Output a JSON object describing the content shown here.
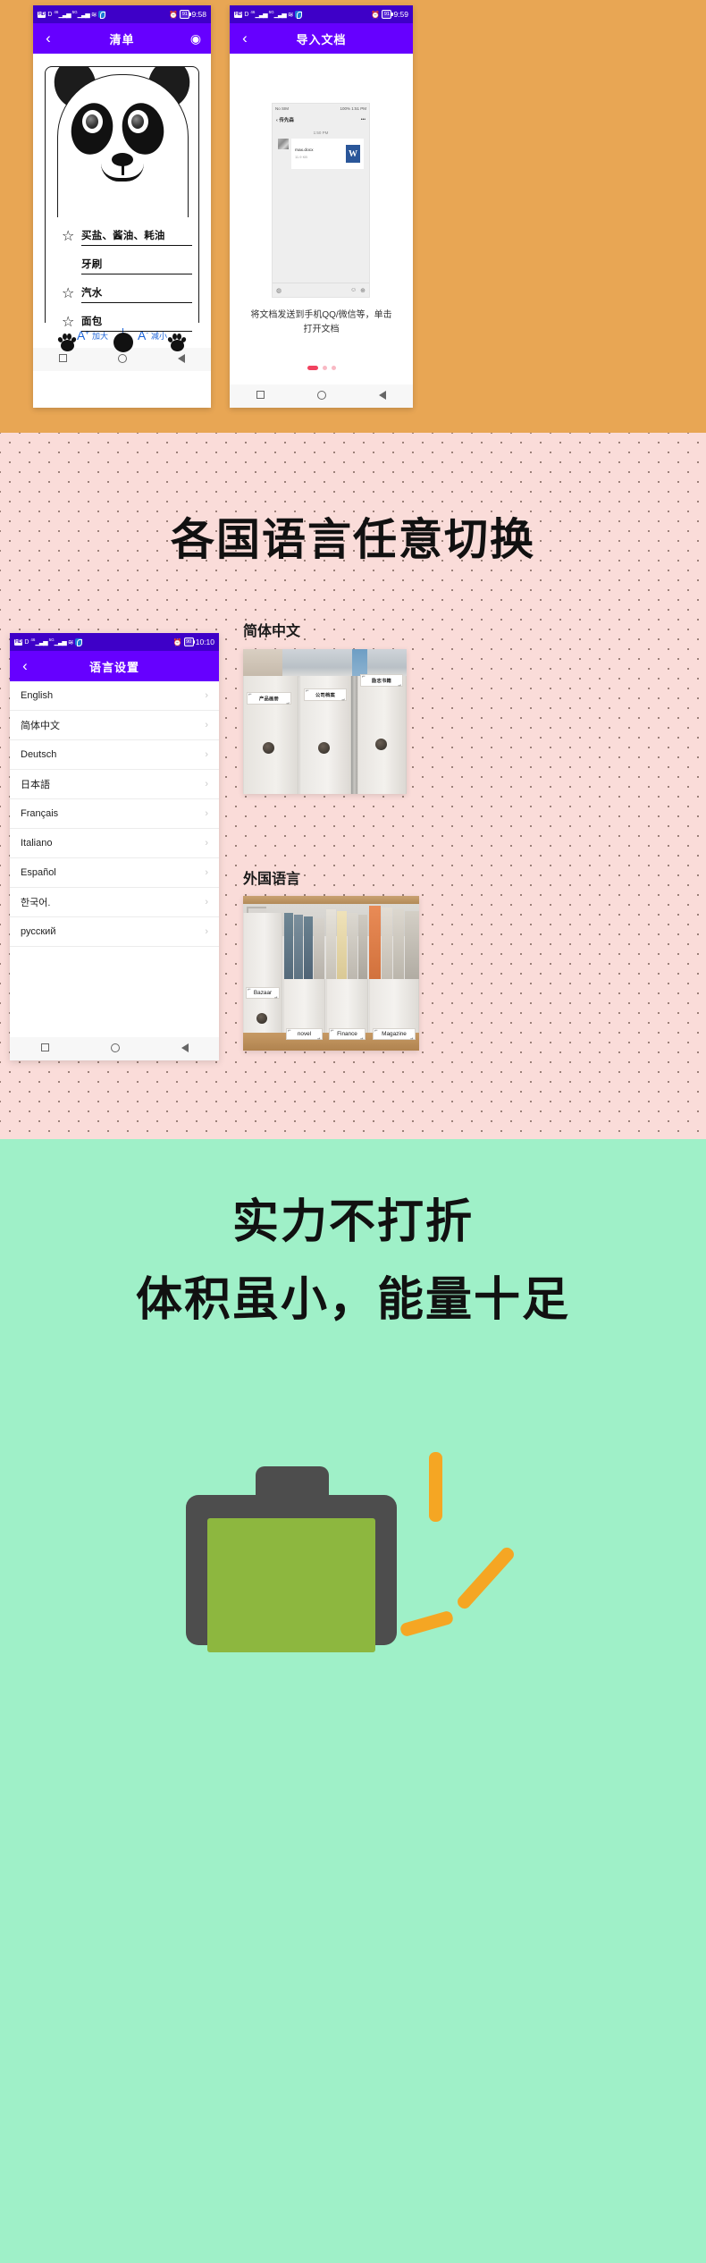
{
  "sections": {
    "top": {
      "bg_color": "#e8a654",
      "phone_list": {
        "status": {
          "hd_label": "HD",
          "data_label": "D",
          "net1": "46",
          "net2": "5G",
          "alarm_icon": "alarm-icon",
          "battery": "91",
          "time": "9:58"
        },
        "nav": {
          "back_icon": "chevron-left-icon",
          "title": "清单",
          "right_icon": "eye-icon"
        },
        "items": [
          {
            "starred": true,
            "text": "买盐、酱油、耗油"
          },
          {
            "starred": false,
            "text": "牙刷"
          },
          {
            "starred": true,
            "text": "汽水"
          },
          {
            "starred": true,
            "text": "面包"
          }
        ],
        "toolbar": {
          "increase_glyph": "A",
          "increase_sup": "+",
          "increase_label": "加大",
          "decrease_glyph": "A",
          "decrease_sup": "-",
          "decrease_label": "减小"
        }
      },
      "phone_import": {
        "status": {
          "hd_label": "HD",
          "data_label": "D",
          "net1": "46",
          "net2": "5G",
          "alarm_icon": "alarm-icon",
          "battery": "91",
          "time": "9:59"
        },
        "nav": {
          "back_icon": "chevron-left-icon",
          "title": "导入文档"
        },
        "mock": {
          "status_left": "No SIM",
          "status_right": "100%",
          "status_time": "1:51 PM",
          "nav_title": "传先森",
          "more_icon": "more-horizontal-icon",
          "msg_time": "1:50 PM",
          "file_name": "max.docx",
          "file_size": "11.9 KB",
          "file_type_glyph": "W",
          "mic_icon": "voice-icon",
          "emoji_icon": "emoji-icon",
          "plus_icon": "plus-icon"
        },
        "caption": "将文档发送到手机QQ/微信等，单击\n打开文档",
        "pagination": {
          "active": 0,
          "count": 3
        }
      }
    },
    "middle": {
      "bg_color": "#fadcd9",
      "heading": "各国语言任意切换",
      "phone_lang": {
        "status": {
          "hd_label": "HD",
          "data_label": "D",
          "net1": "46",
          "net2": "5G",
          "alarm_icon": "alarm-icon",
          "battery": "90",
          "time": "10:10"
        },
        "nav": {
          "back_icon": "chevron-left-icon",
          "title": "语言设置"
        },
        "languages": [
          "English",
          "简体中文",
          "Deutsch",
          "日本語",
          "Français",
          "Italiano",
          "Español",
          "한국어.",
          "русский"
        ],
        "chevron": "›"
      },
      "photo_cn": {
        "label": "简体中文",
        "binder_labels": [
          "产品画册",
          "公司档案",
          "励志书籍"
        ]
      },
      "photo_foreign": {
        "label": "外国语言",
        "box_labels": [
          "Bazaar",
          "novel",
          "Finance",
          "Magazine"
        ]
      }
    },
    "bottom": {
      "bg_color": "#9ff0c8",
      "line1": "实力不打折",
      "line2": "体积虽小，能量十足",
      "battery_shell_color": "#4d4d4d",
      "battery_fill_color": "#8db73f",
      "spark_color": "#f5a623"
    }
  },
  "sysnav": {
    "recents_icon": "square-icon",
    "home_icon": "circle-icon",
    "back_icon": "triangle-back-icon"
  }
}
